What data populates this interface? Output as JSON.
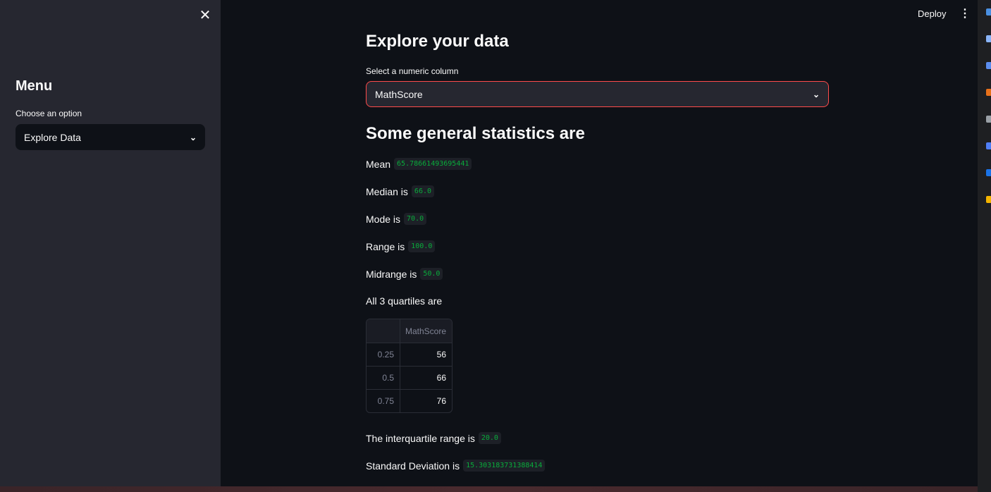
{
  "sidebar": {
    "close_label": "✕",
    "title": "Menu",
    "choose_label": "Choose an option",
    "selected_option": "Explore Data"
  },
  "header": {
    "deploy_label": "Deploy",
    "more_label": "⋮"
  },
  "main": {
    "title": "Explore your data",
    "select_label": "Select a numeric column",
    "selected_column": "MathScore",
    "stats_title": "Some general statistics are",
    "stats": [
      {
        "label": "Mean",
        "value": "65.78661493695441"
      },
      {
        "label": "Median is",
        "value": "66.0"
      },
      {
        "label": "Mode is",
        "value": "70.0"
      },
      {
        "label": "Range is",
        "value": "100.0"
      },
      {
        "label": "Midrange is",
        "value": "50.0"
      }
    ],
    "quartiles_label": "All 3 quartiles are",
    "quartiles_table": {
      "column_header": "MathScore",
      "rows": [
        {
          "index": "0.25",
          "value": "56"
        },
        {
          "index": "0.5",
          "value": "66"
        },
        {
          "index": "0.75",
          "value": "76"
        }
      ]
    },
    "iqr": {
      "label": "The interquartile range is",
      "value": "20.0"
    },
    "std": {
      "label": "Standard Deviation is",
      "value": "15.303183731388414"
    }
  },
  "colors": {
    "accent": "#ff4b4b",
    "code_text": "#09ab3b",
    "sidebar_bg": "#262730",
    "main_bg": "#0e1117"
  },
  "icons": {
    "close": "close-icon",
    "dropdown": "chevron-down-icon",
    "more": "kebab-menu-icon"
  }
}
